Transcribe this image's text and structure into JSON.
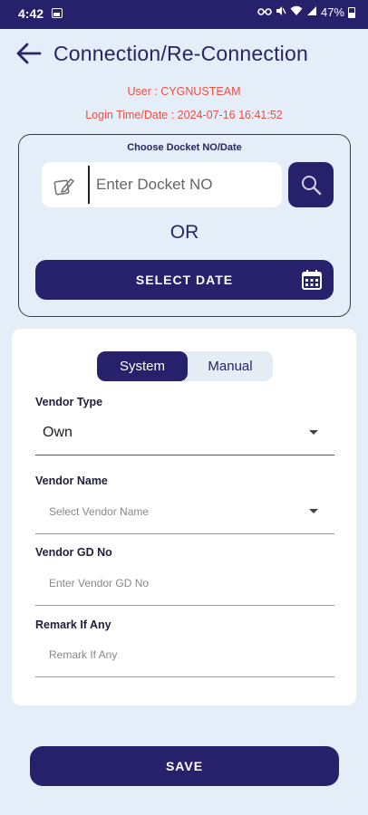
{
  "status_bar": {
    "time": "4:42",
    "battery": "47%",
    "icons": [
      "image-icon",
      "key-icon",
      "mute-icon",
      "wifi-icon",
      "signal-icon",
      "battery-icon"
    ]
  },
  "header": {
    "title": "Connection/Re-Connection"
  },
  "session": {
    "user_line": "User : CYGNUSTEAM",
    "login_line": "Login Time/Date : 2024-07-16 16:41:52"
  },
  "docket": {
    "heading": "Choose Docket NO/Date",
    "input_placeholder": "Enter Docket NO",
    "input_value": "",
    "or_text": "OR",
    "select_date_label": "SELECT DATE"
  },
  "form": {
    "toggle": {
      "options": [
        "System",
        "Manual"
      ],
      "selected": "System"
    },
    "vendor_type": {
      "label": "Vendor Type",
      "value": "Own"
    },
    "vendor_name": {
      "label": "Vendor Name",
      "placeholder": "Select Vendor Name"
    },
    "vendor_gd_no": {
      "label": "Vendor GD No",
      "placeholder": "Enter Vendor GD No"
    },
    "remark": {
      "label": "Remark If Any",
      "placeholder": "Remark If Any"
    }
  },
  "actions": {
    "save_label": "SAVE"
  },
  "colors": {
    "primary": "#27206b",
    "background": "#e3eef8",
    "accent_text": "#ef4f45"
  }
}
